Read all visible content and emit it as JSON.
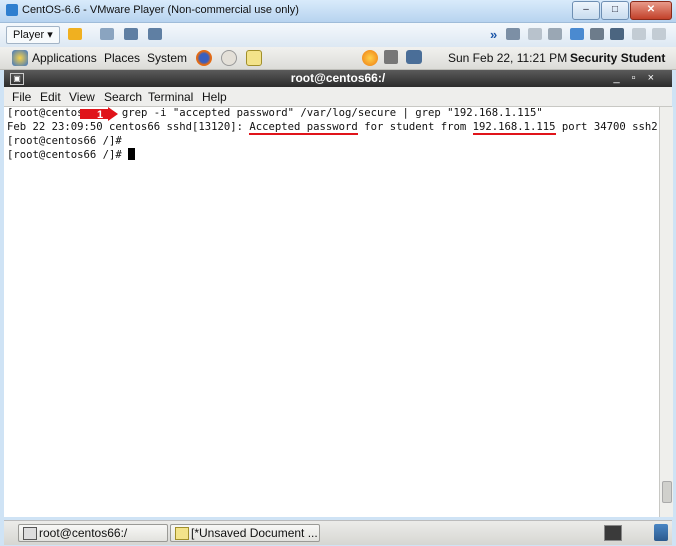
{
  "window": {
    "title": "CentOS-6.6 - VMware Player (Non-commercial use only)",
    "minimize": "–",
    "maximize": "□",
    "close": "✕"
  },
  "vmware": {
    "player_label": "Player ▾",
    "chevron": "»"
  },
  "panel": {
    "applications": "Applications",
    "places": "Places",
    "system": "System",
    "clock": "Sun Feb 22, 11:21 PM",
    "user": "Security Student"
  },
  "terminal": {
    "title": "root@centos66:/",
    "menu": [
      "File",
      "Edit",
      "View",
      "Search",
      "Terminal",
      "Help"
    ],
    "lines": {
      "l1_prompt": "[root@centos",
      "l1_cmd": "grep -i \"accepted password\" /var/log/secure | grep \"192.168.1.115\"",
      "l2_a": "Feb 22 23:09:50 centos66 sshd[13120]: ",
      "l2_b": "Accepted password",
      "l2_c": " for student from ",
      "l2_d": "192.168.1.115",
      "l2_e": " port 34700 ssh2",
      "l3": "[root@centos66 /]#",
      "l4": "[root@centos66 /]# "
    },
    "callout_number": "1"
  },
  "taskbar": {
    "task1": "root@centos66:/",
    "task2": "[*Unsaved Document ..."
  },
  "colors": {
    "underline": "#e0141a",
    "callout": "#e0141a"
  }
}
